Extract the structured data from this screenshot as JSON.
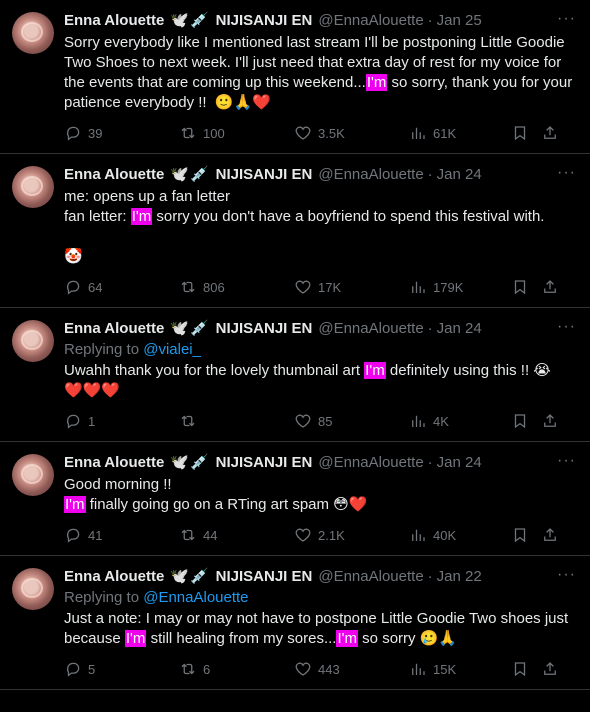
{
  "tweets": [
    {
      "name": "Enna Alouette",
      "badges": "🕊️💉",
      "affiliation": "NIJISANJI EN",
      "handle": "@EnnaAlouette",
      "date": "Jan 25",
      "reply_prefix": "",
      "reply_handle": "",
      "lines": [
        [
          {
            "t": "Sorry everybody like I mentioned last stream I'll be postponing Little Goodie Two Shoes to next week. I'll just need that extra day of rest for my voice for the events that are coming up this weekend..."
          },
          {
            "t": "I'm",
            "hl": true
          },
          {
            "t": " so sorry, thank you for your patience everybody !!  🙂🙏❤️"
          }
        ]
      ],
      "replies": "39",
      "retweets": "100",
      "likes": "3.5K",
      "views": "61K"
    },
    {
      "name": "Enna Alouette",
      "badges": "🕊️💉",
      "affiliation": "NIJISANJI EN",
      "handle": "@EnnaAlouette",
      "date": "Jan 24",
      "reply_prefix": "",
      "reply_handle": "",
      "lines": [
        [
          {
            "t": "me: opens up a fan letter"
          }
        ],
        [
          {
            "t": "fan letter: "
          },
          {
            "t": "I'm",
            "hl": true
          },
          {
            "t": " sorry you don't have a boyfriend to spend this festival with."
          }
        ],
        [
          {
            "t": " "
          }
        ],
        [
          {
            "t": "🤡"
          }
        ]
      ],
      "replies": "64",
      "retweets": "806",
      "likes": "17K",
      "views": "179K"
    },
    {
      "name": "Enna Alouette",
      "badges": "🕊️💉",
      "affiliation": "NIJISANJI EN",
      "handle": "@EnnaAlouette",
      "date": "Jan 24",
      "reply_prefix": "Replying to ",
      "reply_handle": "@vialei_",
      "lines": [
        [
          {
            "t": "Uwahh thank you for the lovely thumbnail art "
          },
          {
            "t": "I'm",
            "hl": true
          },
          {
            "t": " definitely using this !! 😭"
          }
        ],
        [
          {
            "t": "❤️❤️❤️"
          }
        ]
      ],
      "replies": "1",
      "retweets": "",
      "likes": "85",
      "views": "4K"
    },
    {
      "name": "Enna Alouette",
      "badges": "🕊️💉",
      "affiliation": "NIJISANJI EN",
      "handle": "@EnnaAlouette",
      "date": "Jan 24",
      "reply_prefix": "",
      "reply_handle": "",
      "lines": [
        [
          {
            "t": "Good morning !!"
          }
        ],
        [
          {
            "t": "I'm",
            "hl": true
          },
          {
            "t": " finally going go on a RTing art spam 😳❤️"
          }
        ]
      ],
      "replies": "41",
      "retweets": "44",
      "likes": "2.1K",
      "views": "40K"
    },
    {
      "name": "Enna Alouette",
      "badges": "🕊️💉",
      "affiliation": "NIJISANJI EN",
      "handle": "@EnnaAlouette",
      "date": "Jan 22",
      "reply_prefix": "Replying to ",
      "reply_handle": "@EnnaAlouette",
      "lines": [
        [
          {
            "t": "Just a note: I may or may not have to postpone Little Goodie Two shoes just because "
          },
          {
            "t": "I'm",
            "hl": true
          },
          {
            "t": " still healing from my sores..."
          },
          {
            "t": "I'm",
            "hl": true
          },
          {
            "t": " so sorry 🥲🙏"
          }
        ]
      ],
      "replies": "5",
      "retweets": "6",
      "likes": "443",
      "views": "15K"
    }
  ],
  "icons": {
    "more": "more-icon",
    "reply": "reply-icon",
    "retweet": "retweet-icon",
    "like": "heart-icon",
    "views": "views-icon",
    "bookmark": "bookmark-icon",
    "share": "share-icon"
  },
  "colors": {
    "background": "#000000",
    "text": "#e7e9ea",
    "muted": "#71767b",
    "link": "#1d9bf0",
    "highlight": "#ee00ee",
    "divider": "#2f3336"
  }
}
